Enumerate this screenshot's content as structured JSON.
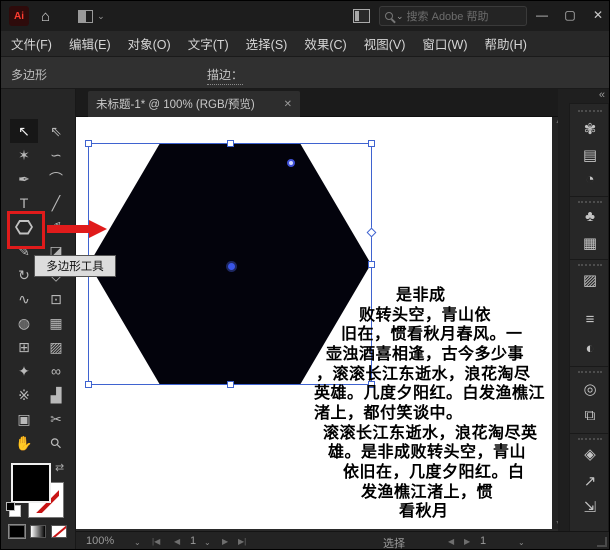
{
  "colors": {
    "accent_red": "#e01b1b",
    "selection_blue": "#3f63d0",
    "artboard_white": "#ffffff",
    "hexagon_fill": "#03030c",
    "ui_dark": "#262626"
  },
  "titlebar": {
    "logo_text": "Ai",
    "search_placeholder": "搜索 Adobe 帮助",
    "minimize_glyph": "—",
    "maximize_glyph": "▢",
    "close_glyph": "✕"
  },
  "menubar": {
    "items": [
      "文件(F)",
      "编辑(E)",
      "对象(O)",
      "文字(T)",
      "选择(S)",
      "效果(C)",
      "视图(V)",
      "窗口(W)",
      "帮助(H)"
    ]
  },
  "options_bar": {
    "tool_label": "多边形",
    "stroke_label": "描边：",
    "stepper_up": "⌃",
    "stepper_down": "⌄",
    "chevron": "⌄",
    "icons": {
      "grid": "∷",
      "panel_toggle": "⋮P",
      "menu": "≣"
    }
  },
  "tabbar": {
    "title": "未标题-1* @ 100% (RGB/预览)",
    "close_glyph": "✕"
  },
  "toolbar": {
    "tools": [
      {
        "name": "selection-tool",
        "glyph": "↖"
      },
      {
        "name": "direct-selection-tool",
        "glyph": "⇖"
      },
      {
        "name": "magic-wand-tool",
        "glyph": "✶"
      },
      {
        "name": "lasso-tool",
        "glyph": "∽"
      },
      {
        "name": "pen-tool",
        "glyph": "✒"
      },
      {
        "name": "curvature-tool",
        "glyph": "⌒"
      },
      {
        "name": "type-tool",
        "glyph": "T"
      },
      {
        "name": "line-segment-tool",
        "glyph": "╱"
      },
      {
        "name": "polygon-tool",
        "glyph": ""
      },
      {
        "name": "paintbrush-tool",
        "glyph": "✐"
      },
      {
        "name": "shaper-tool",
        "glyph": "✎"
      },
      {
        "name": "eraser-tool",
        "glyph": "◪"
      },
      {
        "name": "rotate-tool",
        "glyph": "↻"
      },
      {
        "name": "scale-tool",
        "glyph": "◇"
      },
      {
        "name": "width-tool",
        "glyph": "∿"
      },
      {
        "name": "free-transform-tool",
        "glyph": "⊡"
      },
      {
        "name": "shape-builder-tool",
        "glyph": "◍"
      },
      {
        "name": "perspective-grid-tool",
        "glyph": "▦"
      },
      {
        "name": "mesh-tool",
        "glyph": "⊞"
      },
      {
        "name": "gradient-tool",
        "glyph": "▨"
      },
      {
        "name": "eyedropper-tool",
        "glyph": "✦"
      },
      {
        "name": "blend-tool",
        "glyph": "∞"
      },
      {
        "name": "symbol-sprayer-tool",
        "glyph": "※"
      },
      {
        "name": "column-graph-tool",
        "glyph": "▟"
      },
      {
        "name": "artboard-tool",
        "glyph": "▣"
      },
      {
        "name": "slice-tool",
        "glyph": "✂"
      },
      {
        "name": "hand-tool",
        "glyph": "✋"
      },
      {
        "name": "zoom-tool",
        "glyph": "⚲"
      }
    ],
    "swap_glyph": "⇄"
  },
  "tooltip": {
    "text": "多边形工具"
  },
  "canvas": {
    "text_lines": [
      "是非成",
      "败转头空，青山依",
      "旧在，惯看秋月春风。一",
      "壶浊酒喜相逢，古今多少事",
      "，滚滚长江东逝水，浪花淘尽",
      "英雄。几度夕阳红。白发渔樵江",
      "渚上，都付笑谈中。",
      "滚滚长江东逝水，浪花淘尽英",
      "雄。是非成败转头空，青山",
      "依旧在，几度夕阳红。白",
      "发渔樵江渚上，惯",
      "看秋月"
    ]
  },
  "right_panel": {
    "collapse_glyph": "«",
    "icons": [
      {
        "name": "color-panel-icon",
        "glyph": "✾"
      },
      {
        "name": "libraries-panel-icon",
        "glyph": "▤"
      },
      {
        "name": "color-guide-panel-icon",
        "glyph": "◔"
      },
      {
        "name": "symbols-panel-icon",
        "glyph": "♣"
      },
      {
        "name": "swatches-panel-icon",
        "glyph": "▦"
      },
      {
        "name": "gradient-panel-icon",
        "glyph": "▨"
      },
      {
        "name": "stroke-panel-icon",
        "glyph": "≡"
      },
      {
        "name": "transparency-panel-icon",
        "glyph": "◐"
      },
      {
        "name": "appearance-panel-icon",
        "glyph": "◎"
      },
      {
        "name": "artboards-panel-icon",
        "glyph": "⧉"
      },
      {
        "name": "layers-panel-icon",
        "glyph": "◈"
      },
      {
        "name": "export-panel-icon",
        "glyph": "↗"
      },
      {
        "name": "asset-export-panel-icon",
        "glyph": "⇲"
      }
    ]
  },
  "status_bar": {
    "zoom_level": "100%",
    "chevron": "⌄",
    "nav": {
      "first": "|◀",
      "prev": "◀",
      "value": "1",
      "next": "▶",
      "last": "▶|"
    },
    "selection_label": "选择",
    "right_nav": {
      "prev": "◀",
      "next": "▶",
      "value": "1"
    }
  }
}
